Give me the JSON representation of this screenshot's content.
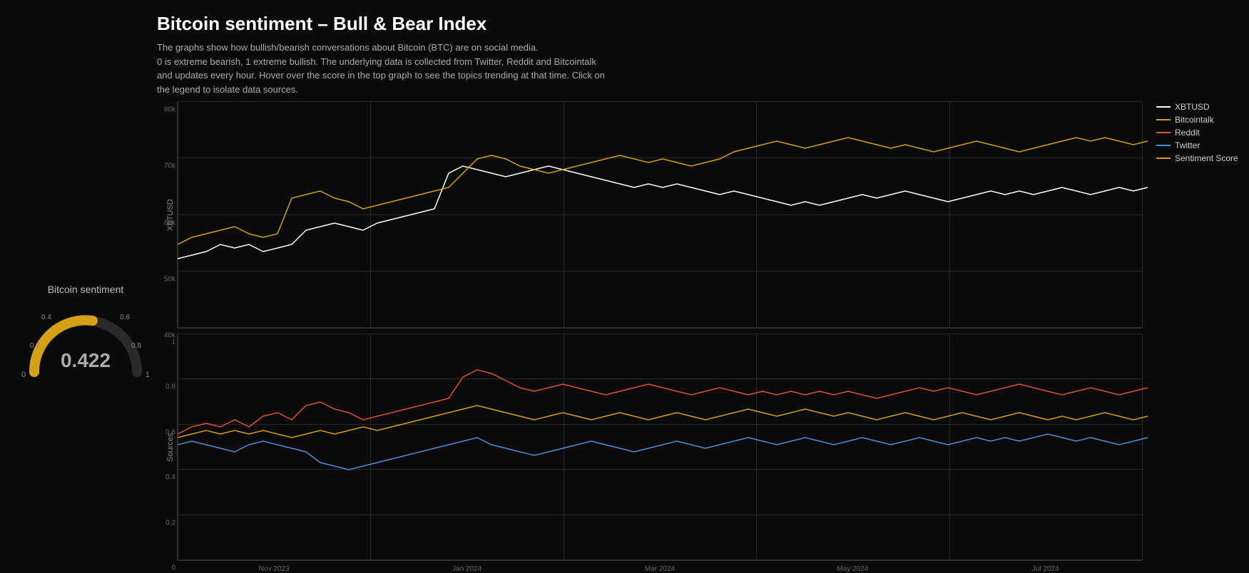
{
  "header": {
    "title": "Bitcoin sentiment – Bull & Bear Index",
    "description1": "The graphs show how bullish/bearish conversations about Bitcoin (BTC) are on social media.",
    "description2": "0 is extreme bearish, 1 extreme bullish. The underlying data is collected from Twitter, Reddit and Bitcointalk",
    "description3": "and updates every hour. Hover over the score in the top graph to see the topics trending at that time. Click on",
    "description4": "the legend to isolate data sources."
  },
  "gauge": {
    "title": "Bitcoin sentiment",
    "value": "0.422",
    "min": "0",
    "max": "1",
    "label_02": "0.2",
    "label_04": "0.4",
    "label_06": "0.6",
    "label_08": "0.8"
  },
  "legend": {
    "items": [
      {
        "label": "XBTUSD",
        "color": "#ffffff"
      },
      {
        "label": "Bitcointalk",
        "color": "#d4a017"
      },
      {
        "label": "Reddit",
        "color": "#e05030"
      },
      {
        "label": "Twitter",
        "color": "#4a90d9"
      },
      {
        "label": "Sentiment Score",
        "color": "#d4a017"
      }
    ]
  },
  "top_chart": {
    "y_label": "XBTUSD",
    "y_ticks": [
      "40k",
      "50k",
      "60k",
      "70k",
      "80k"
    ],
    "x_ticks": [
      "Nov 2023",
      "Jan 2024",
      "Mar 2024",
      "May 2024",
      "Jul 2024"
    ]
  },
  "bottom_chart": {
    "y_label": "Sources",
    "y_ticks": [
      "0",
      "0.2",
      "0.4",
      "0.6",
      "0.8",
      "1"
    ],
    "x_ticks": [
      "Nov 2023",
      "Jan 2024",
      "Mar 2024",
      "May 2024",
      "Jul 2024"
    ]
  },
  "colors": {
    "background": "#0a0a0a",
    "xbtusd": "#ffffff",
    "bitcointalk": "#d4a017",
    "reddit": "#e05030",
    "twitter": "#4a90d9",
    "sentiment": "#d4a017",
    "grid": "#2a2a2a"
  }
}
